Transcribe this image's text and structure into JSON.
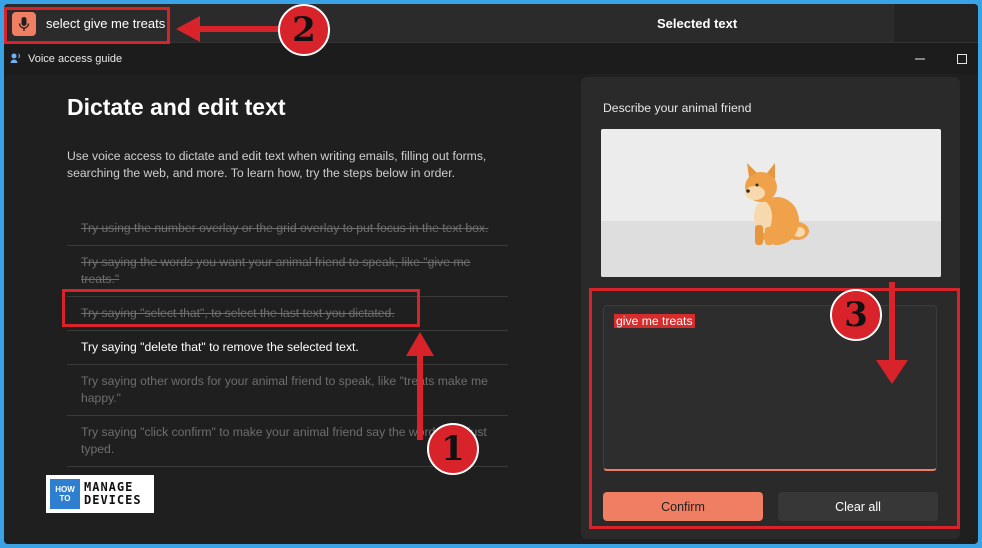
{
  "voice_access": {
    "command_text": "select give me treats",
    "status_title": "Selected text"
  },
  "window": {
    "title": "Voice access guide"
  },
  "left": {
    "heading": "Dictate and edit text",
    "description": "Use voice access to dictate and edit text when writing emails, filling out forms, searching the web, and more. To learn how, try the steps below in order.",
    "steps": [
      {
        "text": "Try using the number overlay or the grid overlay to put focus in the text box.",
        "state": "done"
      },
      {
        "text": "Try saying the words you want your animal friend to speak, like \"give me treats.\"",
        "state": "done"
      },
      {
        "text": "Try saying \"select that\", to select the last text you dictated.",
        "state": "done"
      },
      {
        "text": "Try saying \"delete that\" to remove the selected text.",
        "state": "current"
      },
      {
        "text": "Try saying other words for your animal friend to speak, like \"treats make me happy.\"",
        "state": "pending"
      },
      {
        "text": "Try saying \"click confirm\" to make your animal friend say the words you just typed.",
        "state": "pending"
      }
    ]
  },
  "right": {
    "prompt": "Describe your animal friend",
    "text_value": "give me treats",
    "confirm_label": "Confirm",
    "clear_label": "Clear all"
  },
  "annotations": {
    "badge_1": "1",
    "badge_2": "2",
    "badge_3": "3",
    "color": "#d9232b"
  },
  "logo": {
    "how_to": [
      "HOW",
      "TO"
    ],
    "manage": "MANAGE",
    "devices": "DEVICES"
  },
  "colors": {
    "accent": "#ef7e63",
    "background": "#1f1f1f",
    "frame": "#3aa3e6",
    "selection": "#d62c2c"
  },
  "icons": {
    "mic": "microphone-icon",
    "app": "voice-access-icon",
    "minimize": "minimize-icon",
    "maximize": "maximize-icon",
    "dog": "shiba-dog-illustration"
  }
}
